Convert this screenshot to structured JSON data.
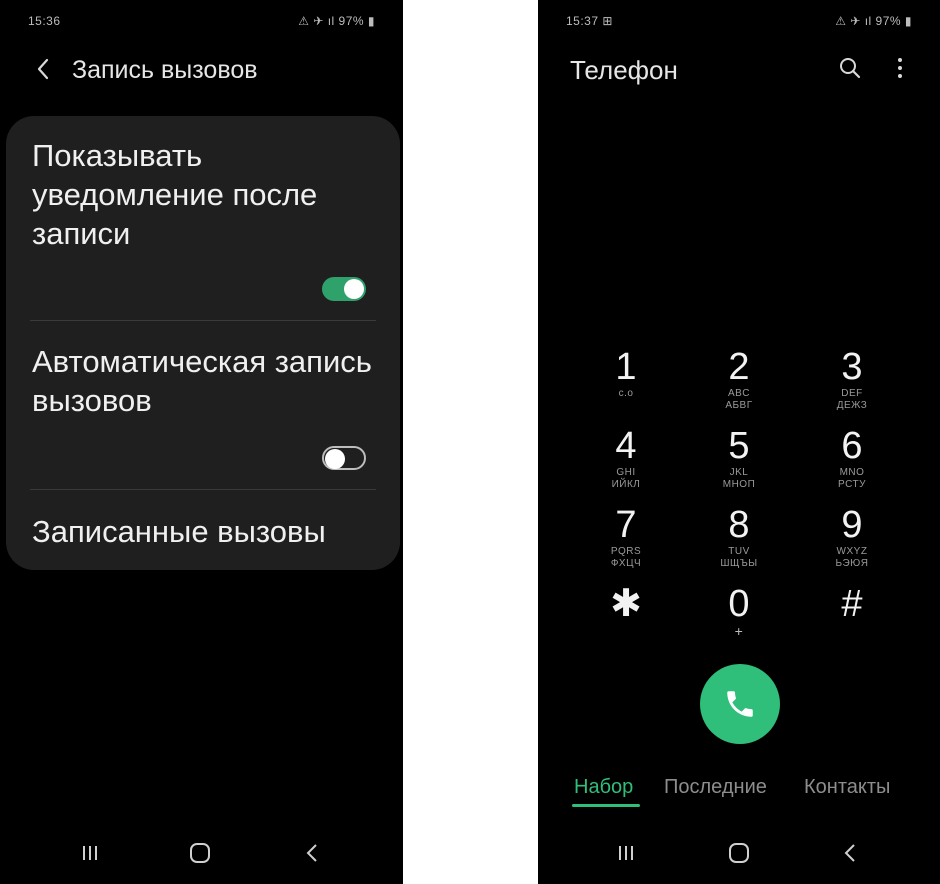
{
  "left_screen": {
    "status": {
      "time": "15:36",
      "icons": "⚠ ✈ ıl 97% ▮"
    },
    "header": {
      "title": "Запись вызовов"
    },
    "settings": [
      {
        "label": "Показывать уведомление после записи",
        "toggle": true
      },
      {
        "label": "Автоматическая запись вызовов",
        "toggle": false
      },
      {
        "label": "Записанные вызовы"
      }
    ]
  },
  "right_screen": {
    "status": {
      "time": "15:37 ⊞",
      "icons": "⚠ ✈ ıl 97% ▮"
    },
    "header": {
      "title": "Телефон"
    },
    "keypad": [
      {
        "num": "1",
        "latin": "ᴄ.ᴏ",
        "cyr": ""
      },
      {
        "num": "2",
        "latin": "ABC",
        "cyr": "АБВГ"
      },
      {
        "num": "3",
        "latin": "DEF",
        "cyr": "ДЕЖЗ"
      },
      {
        "num": "4",
        "latin": "GHI",
        "cyr": "ИЙКЛ"
      },
      {
        "num": "5",
        "latin": "JKL",
        "cyr": "МНОП"
      },
      {
        "num": "6",
        "latin": "MNO",
        "cyr": "РСТУ"
      },
      {
        "num": "7",
        "latin": "PQRS",
        "cyr": "ФХЦЧ"
      },
      {
        "num": "8",
        "latin": "TUV",
        "cyr": "ШЩЪЫ"
      },
      {
        "num": "9",
        "latin": "WXYZ",
        "cyr": "ЬЭЮЯ"
      },
      {
        "num": "✱",
        "latin": "",
        "cyr": ""
      },
      {
        "num": "0",
        "latin": "+",
        "cyr": ""
      },
      {
        "num": "#",
        "latin": "",
        "cyr": ""
      }
    ],
    "tabs": [
      "Набор",
      "Последние",
      "Контакты"
    ],
    "accent_color": "#2fbf7a"
  }
}
